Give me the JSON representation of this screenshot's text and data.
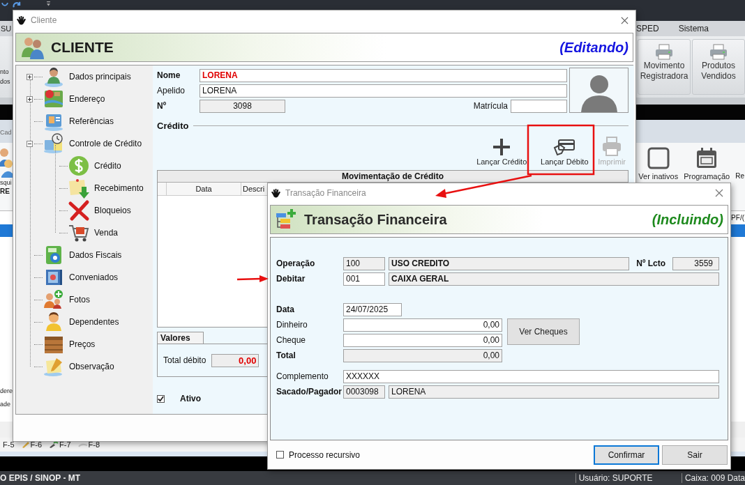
{
  "app": {
    "menu_cut": "SU",
    "menu": [
      "SPED",
      "Sistema"
    ],
    "ribbon_cut": [
      "nto",
      "dos"
    ],
    "ribbon_buttons": [
      {
        "lines": [
          "Movimento",
          "Registradora"
        ]
      },
      {
        "lines": [
          "Produtos",
          "Vendidos"
        ]
      }
    ],
    "tab_cut": "Cad",
    "side_cut": [
      "squi",
      "RE"
    ],
    "toolbar": [
      {
        "label": "Ver inativos"
      },
      {
        "label": "Programação"
      }
    ],
    "toolbar_cut": "Re",
    "column_cut": "PF/(",
    "lower_cut": [
      "dere",
      "ade"
    ],
    "fkeys": [
      "F-5",
      "F-6",
      "F-7",
      "F-8"
    ],
    "status": {
      "location": "O EPIS / SINOP - MT",
      "user": "Usuário: SUPORTE",
      "till": "Caixa: 009 Data"
    }
  },
  "cliente": {
    "title": "Cliente",
    "heading": "CLIENTE",
    "mode": "(Editando)",
    "tree": [
      {
        "label": "Dados principais",
        "kind": "collapsed"
      },
      {
        "label": "Endereço",
        "kind": "collapsed"
      },
      {
        "label": "Referências",
        "kind": "leaf"
      },
      {
        "label": "Controle de Crédito",
        "kind": "expanded",
        "children": [
          {
            "label": "Crédito"
          },
          {
            "label": "Recebimento"
          },
          {
            "label": "Bloqueios"
          },
          {
            "label": "Venda"
          }
        ]
      },
      {
        "label": "Dados Fiscais",
        "kind": "leaf"
      },
      {
        "label": "Conveniados",
        "kind": "leaf"
      },
      {
        "label": "Fotos",
        "kind": "leaf"
      },
      {
        "label": "Dependentes",
        "kind": "leaf"
      },
      {
        "label": "Preços",
        "kind": "leaf"
      },
      {
        "label": "Observação",
        "kind": "leaf"
      }
    ],
    "fields": {
      "name_label": "Nome",
      "name": "LORENA",
      "nickname_label": "Apelido",
      "nickname": "LORENA",
      "number_label": "Nº",
      "number": "3098",
      "registration_label": "Matrícula"
    },
    "credit": {
      "title": "Crédito",
      "actions": [
        {
          "label": "Lançar Crédito",
          "disabled": false
        },
        {
          "label": "Lançar Débito",
          "disabled": false
        },
        {
          "label": "Imprimir",
          "disabled": true
        }
      ],
      "table": {
        "title": "Movimentação de Crédito",
        "columns": [
          "Data",
          "Descri"
        ]
      }
    },
    "totals": {
      "tab": "Valores",
      "label": "Total débito",
      "value": "0,00"
    },
    "active": {
      "label": "Ativo",
      "checked": true
    }
  },
  "transacao": {
    "title": "Transação Financeira",
    "heading": "Transação Financeira",
    "mode": "(Incluindo)",
    "operation": {
      "label": "Operação",
      "code": "100",
      "name": "USO CREDITO",
      "number_label": "Nº Lcto",
      "number": "3559"
    },
    "debit": {
      "label": "Debitar",
      "code": "001",
      "name": "CAIXA GERAL"
    },
    "date": {
      "label": "Data",
      "value": "24/07/2025"
    },
    "amounts": [
      {
        "label": "Dinheiro",
        "value": "0,00",
        "kind": "input"
      },
      {
        "label": "Cheque",
        "value": "0,00",
        "kind": "input"
      },
      {
        "label": "Total",
        "value": "0,00",
        "kind": "total"
      }
    ],
    "checks_button": "Ver Cheques",
    "complement": {
      "label": "Complemento",
      "value": "XXXXXX"
    },
    "payer": {
      "label": "Sacado/Pagador",
      "code": "0003098",
      "name": "LORENA"
    },
    "recursive": {
      "label": "Processo recursivo",
      "checked": false
    },
    "buttons": [
      {
        "label": "Confirmar",
        "focused": true
      },
      {
        "label": "Sair",
        "focused": false
      }
    ]
  }
}
